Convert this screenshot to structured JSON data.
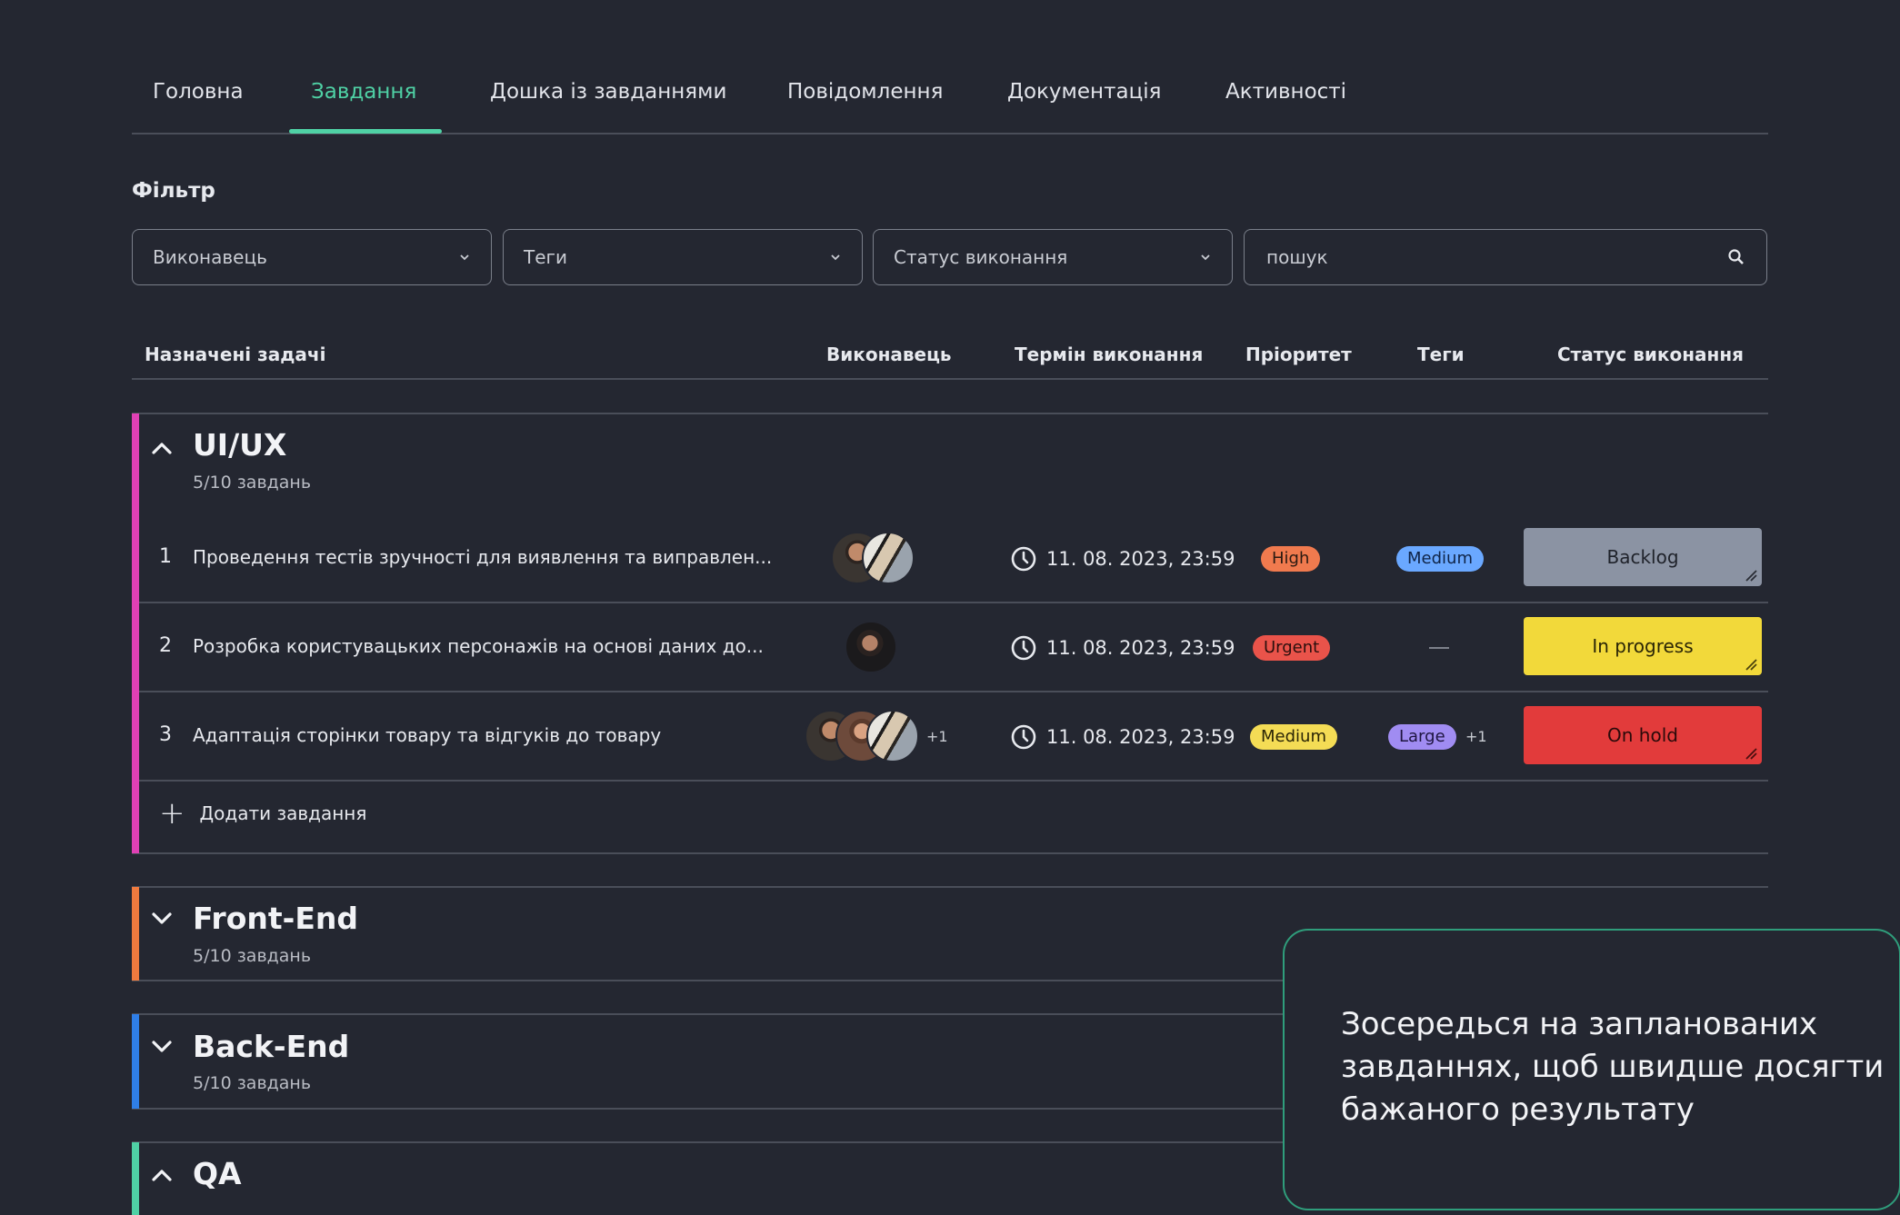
{
  "tabs": [
    {
      "label": "Головна"
    },
    {
      "label": "Завдання"
    },
    {
      "label": "Дошка із завданнями"
    },
    {
      "label": "Повідомлення"
    },
    {
      "label": "Документація"
    },
    {
      "label": "Активності"
    }
  ],
  "active_tab": "Завдання",
  "filter": {
    "title": "Фільтр",
    "assignee": "Виконавець",
    "tags": "Теги",
    "status": "Статус виконання",
    "search_placeholder": "пошук"
  },
  "table_header": {
    "tasks": "Назначені задачі",
    "assignee": "Виконавець",
    "due": "Термін виконання",
    "priority": "Пріоритет",
    "tags": "Теги",
    "status": "Статус виконання"
  },
  "groups": [
    {
      "title": "UI/UX",
      "count": "5/10 завдань",
      "color": "#e040b4",
      "expanded": true,
      "add_label": "Додати завдання",
      "tasks": [
        {
          "num": "1",
          "title": "Проведення тестів зручності для виявлення та виправлен...",
          "extra_assignees": "",
          "due": "11. 08. 2023, 23:59",
          "priority": "High",
          "tag": "Medium",
          "extra_tags": "",
          "status": "Backlog"
        },
        {
          "num": "2",
          "title": "Розробка користувацьких персонажів на основі даних до...",
          "extra_assignees": "",
          "due": "11. 08. 2023, 23:59",
          "priority": "Urgent",
          "tag": "",
          "extra_tags": "",
          "status": "In progress"
        },
        {
          "num": "3",
          "title": "Адаптація сторінки товару та відгуків до товару",
          "extra_assignees": "+1",
          "due": "11. 08. 2023, 23:59",
          "priority": "Medium",
          "tag": "Large",
          "extra_tags": "+1",
          "status": "On hold"
        }
      ]
    },
    {
      "title": "Front-End",
      "count": "5/10 завдань",
      "color": "#ef7a3e",
      "expanded": false
    },
    {
      "title": "Back-End",
      "count": "5/10 завдань",
      "color": "#2f7fe8",
      "expanded": false
    },
    {
      "title": "QA",
      "count": "",
      "color": "#4fd1a5",
      "expanded": true
    }
  ],
  "colors": {
    "priority_high": "#f07a4e",
    "priority_urgent": "#e9534a",
    "priority_medium": "#f4dc55",
    "tag_medium": "#6aa8ff",
    "tag_large": "#a08cf2",
    "status_backlog": "#8b93a3",
    "status_in_progress": "#f2d93a",
    "status_on_hold": "#e23b3b",
    "accent": "#4fd1a5"
  },
  "promo": {
    "text": "Зосередься на запланованих завданнях, щоб швидше досягти бажаного результату"
  }
}
